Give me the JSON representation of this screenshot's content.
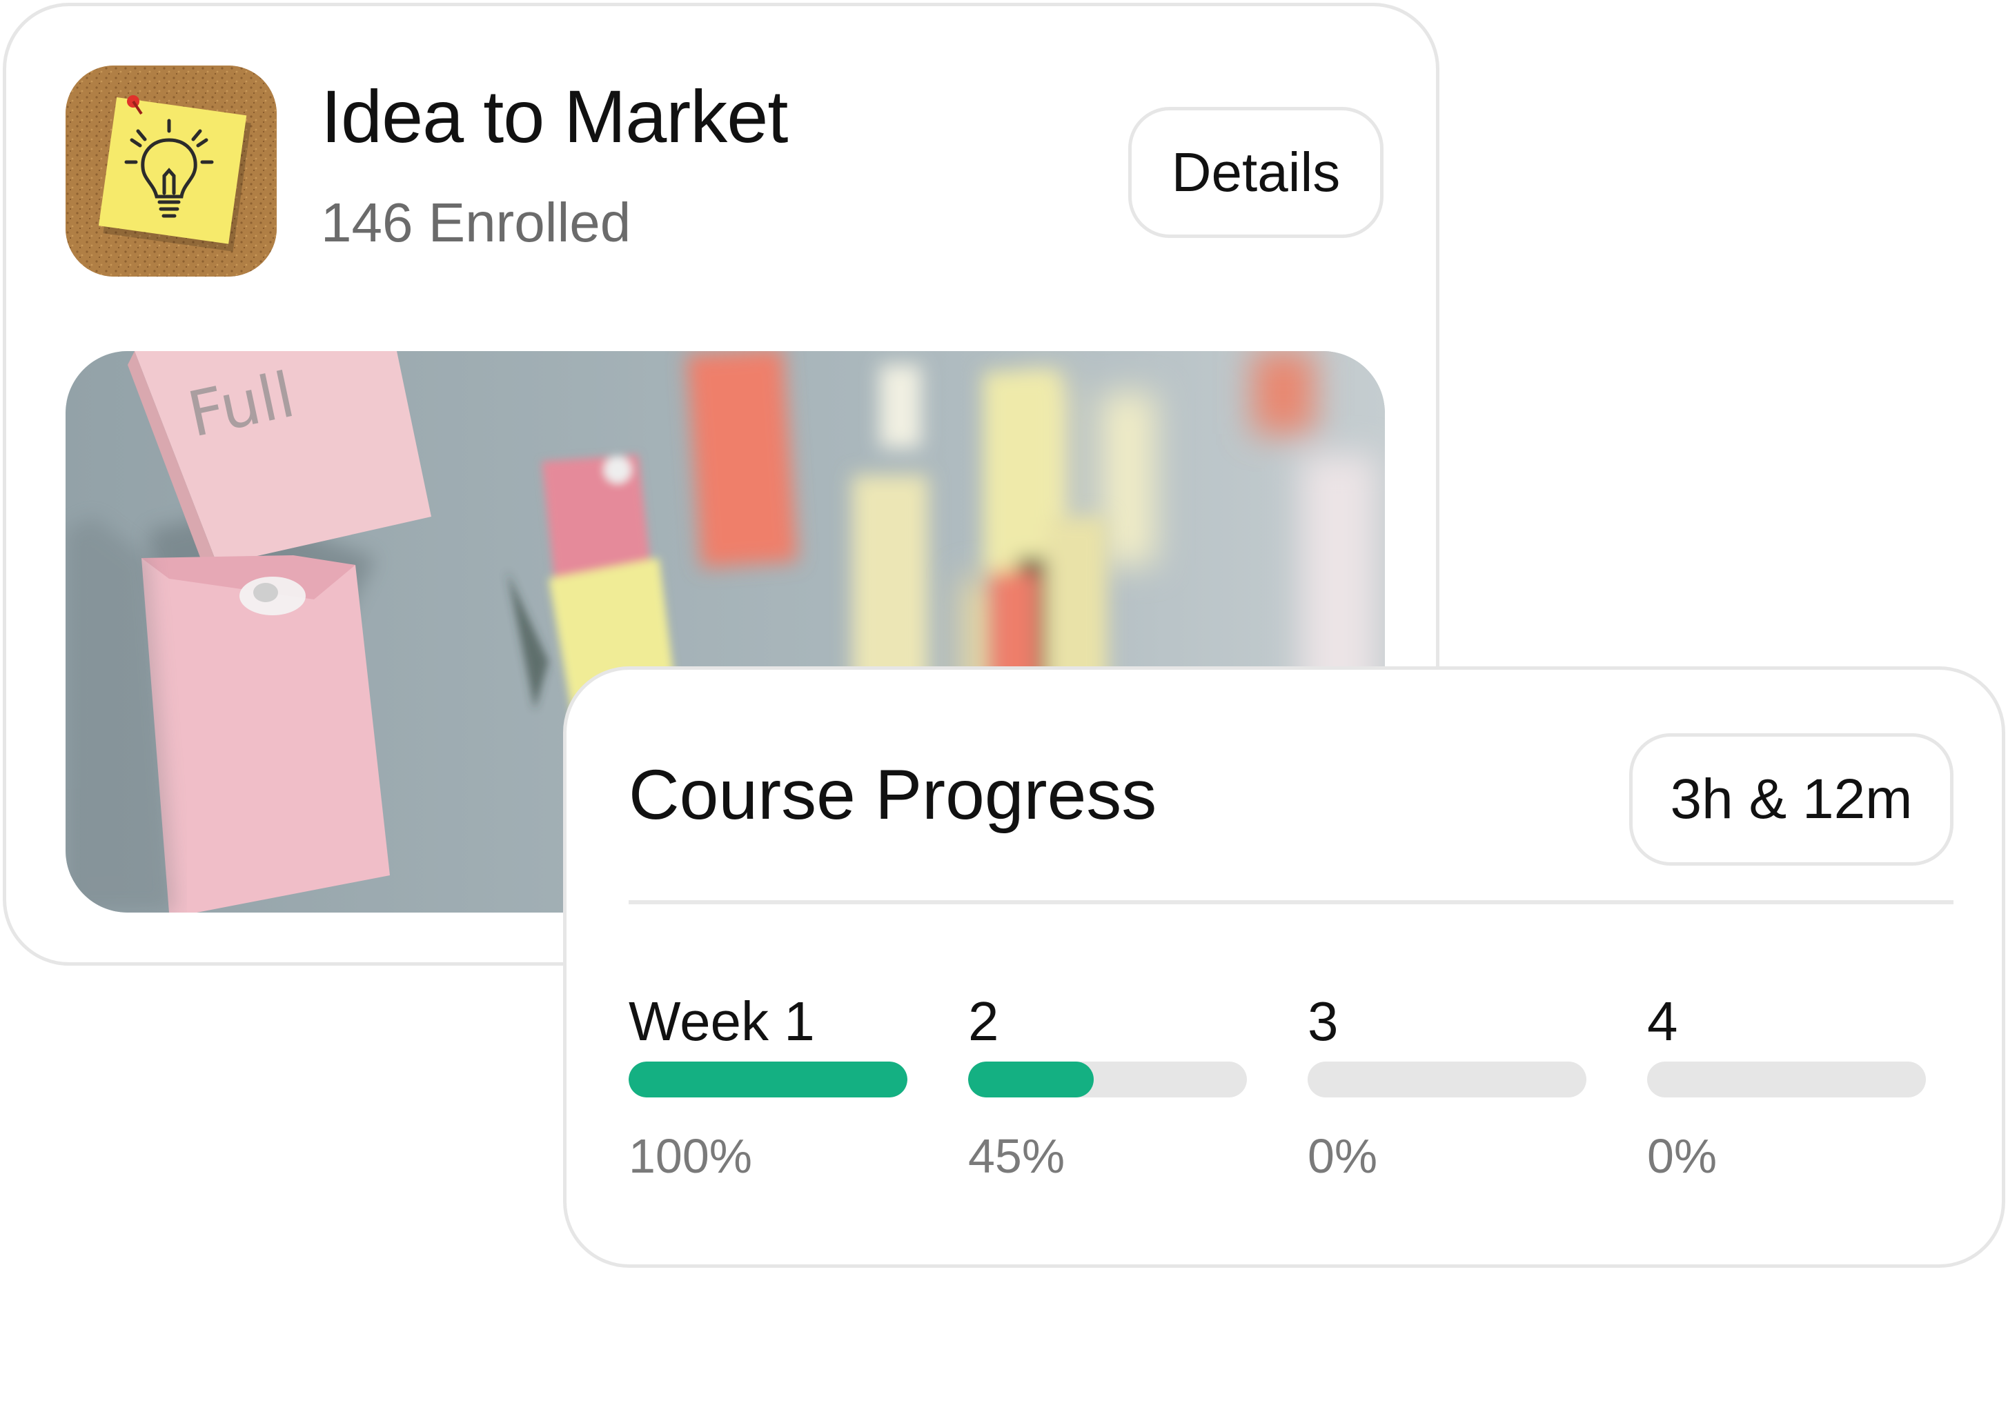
{
  "course": {
    "title": "Idea to Market",
    "enrolled": "146 Enrolled",
    "details_label": "Details",
    "image_note": "Full"
  },
  "progress": {
    "title": "Course Progress",
    "duration": "3h & 12m",
    "weeks": [
      {
        "label": "Week 1",
        "percent_label": "100%",
        "percent": 100
      },
      {
        "label": "2",
        "percent_label": "45%",
        "percent": 45
      },
      {
        "label": "3",
        "percent_label": "0%",
        "percent": 0
      },
      {
        "label": "4",
        "percent_label": "0%",
        "percent": 0
      }
    ]
  },
  "colors": {
    "accent": "#14b082",
    "track": "#e6e6e6",
    "border": "#e6e6e6",
    "muted_text": "#6b6b6b"
  },
  "icons": {
    "course_icon": "lightbulb-sticky-note-icon"
  }
}
